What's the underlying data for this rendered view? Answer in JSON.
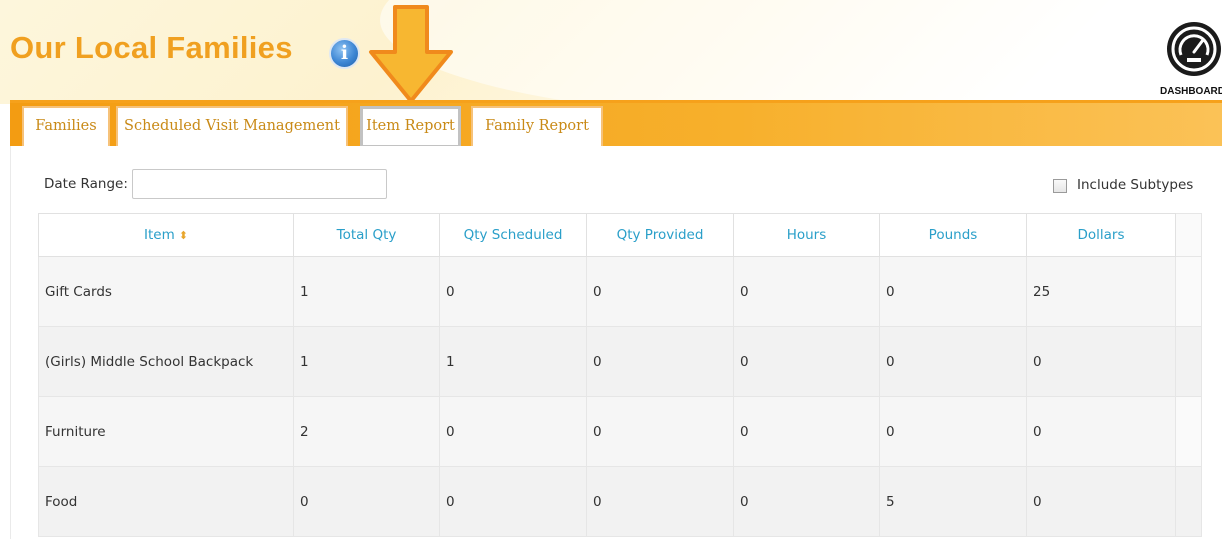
{
  "header": {
    "title": "Our Local Families",
    "info_symbol": "i",
    "dashboard_label": "DASHBOARD"
  },
  "tabs": [
    {
      "label": "Families"
    },
    {
      "label": "Scheduled Visit Management"
    },
    {
      "label": "Item Report",
      "active": true
    },
    {
      "label": "Family Report"
    }
  ],
  "filters": {
    "date_range_label": "Date Range:",
    "date_range_value": "",
    "include_subtypes_label": "Include Subtypes",
    "include_subtypes_checked": false
  },
  "table": {
    "columns": [
      "Item",
      "Total Qty",
      "Qty Scheduled",
      "Qty Provided",
      "Hours",
      "Pounds",
      "Dollars"
    ],
    "sort_icon": "sort-icon",
    "rows": [
      [
        "Gift Cards",
        "1",
        "0",
        "0",
        "0",
        "0",
        "25"
      ],
      [
        "(Girls) Middle School Backpack",
        "1",
        "1",
        "0",
        "0",
        "0",
        "0"
      ],
      [
        "Furniture",
        "2",
        "0",
        "0",
        "0",
        "0",
        "0"
      ],
      [
        "Food",
        "0",
        "0",
        "0",
        "0",
        "5",
        "0"
      ]
    ]
  },
  "colors": {
    "brand_orange": "#f0a020",
    "tab_bar": "#f39c12",
    "link_blue": "#2a9fc9",
    "arrow": "#f7b731"
  }
}
